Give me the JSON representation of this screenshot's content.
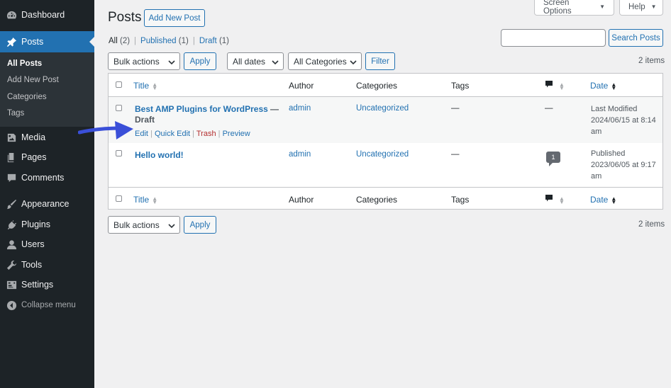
{
  "sidebar": {
    "dashboard": "Dashboard",
    "posts": "Posts",
    "submenu": [
      "All Posts",
      "Add New Post",
      "Categories",
      "Tags"
    ],
    "media": "Media",
    "pages": "Pages",
    "comments": "Comments",
    "appearance": "Appearance",
    "plugins": "Plugins",
    "users": "Users",
    "tools": "Tools",
    "settings": "Settings",
    "collapse": "Collapse menu"
  },
  "header": {
    "title": "Posts",
    "add_new": "Add New Post",
    "screen_options": "Screen Options",
    "help": "Help"
  },
  "views": {
    "all": "All",
    "all_count": "(2)",
    "published": "Published",
    "published_count": "(1)",
    "draft": "Draft",
    "draft_count": "(1)"
  },
  "search": {
    "button": "Search Posts",
    "value": ""
  },
  "filters": {
    "bulk_actions": "Bulk actions",
    "apply": "Apply",
    "dates": "All dates",
    "categories": "All Categories",
    "filter": "Filter",
    "items_count": "2 items"
  },
  "table": {
    "columns": {
      "title": "Title",
      "author": "Author",
      "categories": "Categories",
      "tags": "Tags",
      "date": "Date"
    },
    "rows": [
      {
        "title": "Best AMP Plugins for WordPress",
        "state": "— Draft",
        "actions": {
          "edit": "Edit",
          "quick_edit": "Quick Edit",
          "trash": "Trash",
          "preview": "Preview"
        },
        "author": "admin",
        "categories": "Uncategorized",
        "tags": "—",
        "comments": "—",
        "date_status": "Last Modified",
        "date_line1": "2024/06/15 at 8:14",
        "date_line2": "am"
      },
      {
        "title": "Hello world!",
        "author": "admin",
        "categories": "Uncategorized",
        "tags": "—",
        "comments": "1",
        "date_status": "Published",
        "date_line1": "2023/06/05 at 9:17",
        "date_line2": "am"
      }
    ]
  },
  "colors": {
    "sidebar": "#1d2327",
    "accent": "#2271b1",
    "trash": "#b32d2e",
    "annotation_arrow": "#3a4fd8"
  }
}
